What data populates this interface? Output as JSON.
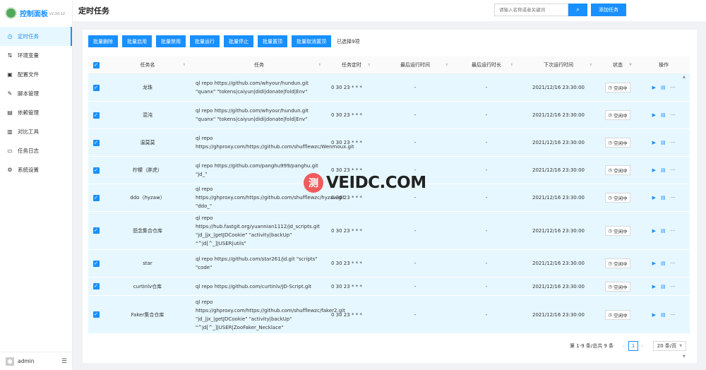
{
  "app": {
    "title": "控制面板",
    "version": "v2.10.12"
  },
  "sidebar": {
    "items": [
      {
        "label": "定时任务",
        "icon": "clock-icon"
      },
      {
        "label": "环境变量",
        "icon": "swap-icon"
      },
      {
        "label": "配置文件",
        "icon": "form-icon"
      },
      {
        "label": "脚本管理",
        "icon": "edit-icon"
      },
      {
        "label": "依赖管理",
        "icon": "code-icon"
      },
      {
        "label": "对比工具",
        "icon": "diff-icon"
      },
      {
        "label": "任务日志",
        "icon": "folder-icon"
      },
      {
        "label": "系统设置",
        "icon": "gear-icon"
      }
    ],
    "user": "admin"
  },
  "header": {
    "title": "定时任务",
    "search_placeholder": "请输入名称或者关键词",
    "add_label": "添加任务"
  },
  "batch": {
    "buttons": [
      "批量删除",
      "批量启用",
      "批量禁用",
      "批量运行",
      "批量停止",
      "批量置顶",
      "批量取消置顶"
    ],
    "selected": "已选择9项"
  },
  "table": {
    "columns": [
      "任务名",
      "任务",
      "任务定时",
      "最后运行时间",
      "最后运行时长",
      "下次运行时间",
      "状态",
      "操作"
    ],
    "rows": [
      {
        "name": "龙珠",
        "command": "ql repo https://github.com/whyour/hundun.git \"quanx\" \"tokens|caiyun|didi|donate|fold|Env\"",
        "cron": "0 30 23 * * *",
        "last_run": "-",
        "last_duration": "-",
        "next_run": "2021/12/16 23:30:00",
        "status": "空闲中"
      },
      {
        "name": "混沌",
        "command": "ql repo https://github.com/whyour/hundun.git \"quanx\" \"tokens|caiyun|didi|donate|fold|Env\"",
        "cron": "0 30 23 * * *",
        "last_run": "-",
        "last_duration": "-",
        "next_run": "2021/12/16 23:30:00",
        "status": "空闲中"
      },
      {
        "name": "温莫莫",
        "command": "ql repo https://ghproxy.com/https://github.com/shufflewzc/Wenmoux.git",
        "cron": "0 30 23 * * *",
        "last_run": "-",
        "last_duration": "-",
        "next_run": "2021/12/16 23:30:00",
        "status": "空闲中"
      },
      {
        "name": "柠檬（胖虎）",
        "command": "ql repo https://github.com/panghu999/panghu.git \"jd_\"",
        "cron": "0 30 23 * * *",
        "last_run": "-",
        "last_duration": "-",
        "next_run": "2021/12/16 23:30:00",
        "status": "空闲中"
      },
      {
        "name": "ddo（hyzaw）",
        "command": "ql repo https://ghproxy.com/https://github.com/shufflewzc/hyzaw.git \"ddo_\"",
        "cron": "0 30 23 * * *",
        "last_run": "-",
        "last_duration": "-",
        "next_run": "2021/12/16 23:30:00",
        "status": "空闲中"
      },
      {
        "name": "怨念集合仓库",
        "command": "ql repo https://hub.fastgit.org/yuannian1112/jd_scripts.git \"jd_|jx_|getJDCookie\" \"activity|backUp\" \"^jd[^_]|USER|utils\"",
        "cron": "0 30 23 * * *",
        "last_run": "-",
        "last_duration": "-",
        "next_run": "2021/12/16 23:30:00",
        "status": "空闲中"
      },
      {
        "name": "star",
        "command": "ql repo https://github.com/star261/jd.git \"scripts\" \"code\"",
        "cron": "0 30 23 * * *",
        "last_run": "-",
        "last_duration": "-",
        "next_run": "2021/12/16 23:30:00",
        "status": "空闲中"
      },
      {
        "name": "curtinlv仓库",
        "command": "ql repo https://github.com/curtinlv/JD-Script.git",
        "cron": "0 30 23 * * *",
        "last_run": "-",
        "last_duration": "-",
        "next_run": "2021/12/16 23:30:00",
        "status": "空闲中"
      },
      {
        "name": "Faker集合仓库",
        "command": "ql repo https://ghproxy.com/https://github.com/shufflewzc/faker2.git \"jd_|jx_|getJDCookie\" \"activity|backUp\" \"^jd[^_]|USER|ZooFaker_Necklace\"",
        "cron": "0 30 23 * * *",
        "last_run": "-",
        "last_duration": "-",
        "next_run": "2021/12/16 23:30:00",
        "status": "空闲中"
      }
    ]
  },
  "pagination": {
    "summary": "第 1-9 条/总共 9 条",
    "current": "1",
    "page_size": "20 条/页"
  },
  "watermark": {
    "badge": "测",
    "text": "VEIDC.COM"
  },
  "colors": {
    "accent": "#1890ff",
    "row_selected": "#e6f7ff"
  }
}
